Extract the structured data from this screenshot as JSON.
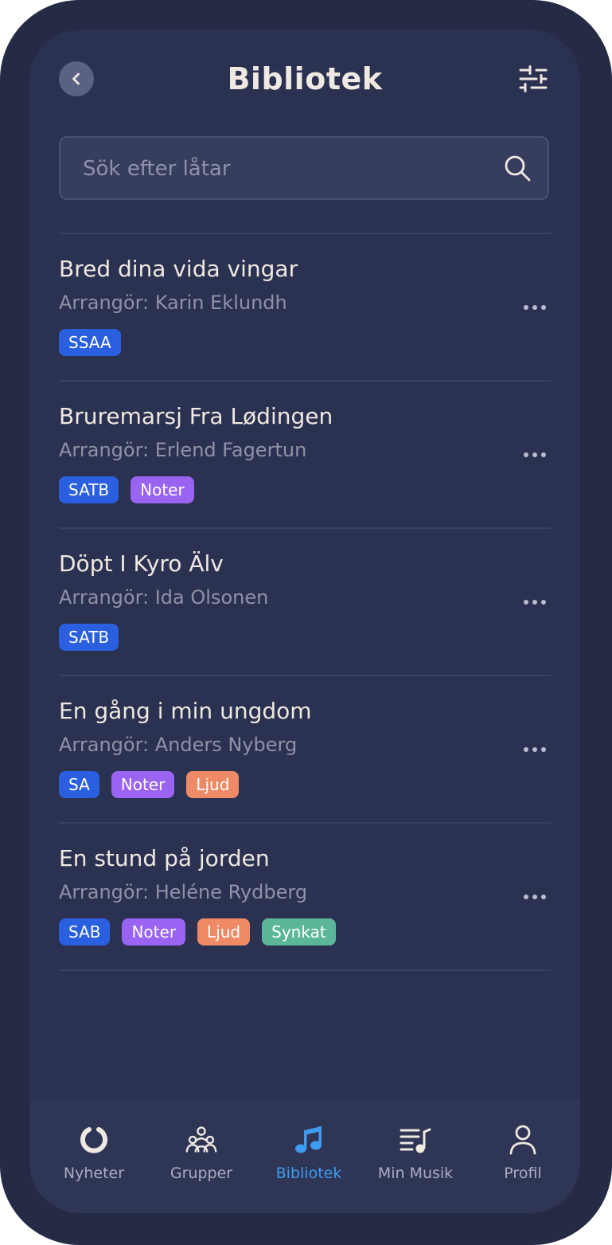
{
  "header": {
    "title": "Bibliotek",
    "back_icon": "chevron-left-icon",
    "filter_icon": "sliders-icon"
  },
  "search": {
    "placeholder": "Sök efter låtar",
    "value": "",
    "icon": "search-icon"
  },
  "colors": {
    "tag_voicing": "#2a5fe0",
    "tag_noter": "#9a63f2",
    "tag_ljud": "#ef8a66",
    "tag_synkat": "#5cb79a",
    "tab_active": "#3d9cf0",
    "tab_inactive": "#a9adc2"
  },
  "songs": [
    {
      "title": "Bred dina vida vingar",
      "arranger": "Arrangör: Karin Eklundh",
      "tags": [
        {
          "label": "SSAA",
          "kind": "voicing"
        }
      ]
    },
    {
      "title": "Bruremarsj Fra Lødingen",
      "arranger": "Arrangör: Erlend Fagertun",
      "tags": [
        {
          "label": "SATB",
          "kind": "voicing"
        },
        {
          "label": "Noter",
          "kind": "noter"
        }
      ]
    },
    {
      "title": "Döpt I Kyro Älv",
      "arranger": "Arrangör: Ida Olsonen",
      "tags": [
        {
          "label": "SATB",
          "kind": "voicing"
        }
      ]
    },
    {
      "title": "En gång i min ungdom",
      "arranger": "Arrangör: Anders Nyberg",
      "tags": [
        {
          "label": "SA",
          "kind": "voicing"
        },
        {
          "label": "Noter",
          "kind": "noter"
        },
        {
          "label": "Ljud",
          "kind": "ljud"
        }
      ]
    },
    {
      "title": "En stund på jorden",
      "arranger": "Arrangör: Heléne Rydberg",
      "tags": [
        {
          "label": "SAB",
          "kind": "voicing"
        },
        {
          "label": "Noter",
          "kind": "noter"
        },
        {
          "label": "Ljud",
          "kind": "ljud"
        },
        {
          "label": "Synkat",
          "kind": "synkat"
        }
      ]
    }
  ],
  "tabbar": {
    "tabs": [
      {
        "label": "Nyheter",
        "icon": "news-ring-icon",
        "active": false
      },
      {
        "label": "Grupper",
        "icon": "group-icon",
        "active": false
      },
      {
        "label": "Bibliotek",
        "icon": "music-note-icon",
        "active": true
      },
      {
        "label": "Min Musik",
        "icon": "playlist-icon",
        "active": false
      },
      {
        "label": "Profil",
        "icon": "profile-icon",
        "active": false
      }
    ]
  }
}
